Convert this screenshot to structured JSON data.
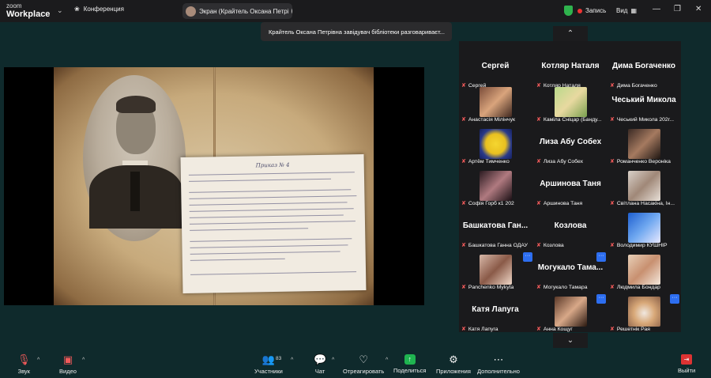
{
  "app": {
    "zoom_label": "zoom",
    "workplace_label": "Workplace"
  },
  "topbar": {
    "conference_label": "Конференция",
    "screen_share_label": "Экран (Крайтель Оксана Петрі",
    "record_label": "Запись",
    "view_label": "Вид"
  },
  "tooltip": {
    "text": "Крайтель Оксана Петрівна завідувач бібліотеки разговариваєт..."
  },
  "shared_screen": {
    "document_title": "Приказ № 4"
  },
  "participants": [
    {
      "big": "Сергей",
      "label": "Сергей"
    },
    {
      "big": "Котляр Наталя",
      "label": "Котляр Наталя"
    },
    {
      "big": "Дима Богаченко",
      "label": "Дима Богаченко"
    },
    {
      "big": "",
      "label": "Анастасія Мілінчук"
    },
    {
      "big": "",
      "label": "Каміла Сніцар (Банду..."
    },
    {
      "big": "Чеський Микола",
      "label": "Чеський Микола 202г..."
    },
    {
      "big": "",
      "label": "Артём Тимченко"
    },
    {
      "big": "Лиза Абу Собех",
      "label": "Лиза Абу Собех"
    },
    {
      "big": "",
      "label": "Романченко Вероніка"
    },
    {
      "big": "",
      "label": "Софія Горб к1 202"
    },
    {
      "big": "Аршинова Таня",
      "label": "Аршинова Таня"
    },
    {
      "big": "",
      "label": "Світлана Насакіна, Ін..."
    },
    {
      "big": "Башкатова Ган...",
      "label": "Башкатова Ганна ОДАУ"
    },
    {
      "big": "Козлова",
      "label": "Козлова"
    },
    {
      "big": "",
      "label": "Володимир КУШНІР"
    },
    {
      "big": "",
      "label": "Panchenko Mykyta"
    },
    {
      "big": "Могукало Тама...",
      "label": "Могукало Тамара"
    },
    {
      "big": "",
      "label": "Людмила Бондар"
    },
    {
      "big": "Катя Лапуга",
      "label": "Катя Лапуга"
    },
    {
      "big": "",
      "label": "Анна Кощуг"
    },
    {
      "big": "",
      "label": "Решетнік Рая"
    }
  ],
  "toolbar": {
    "audio": "Звук",
    "video": "Видео",
    "participants": "Участники",
    "participants_count": "83",
    "chat": "Чат",
    "react": "Отреагировать",
    "share": "Поделиться",
    "apps": "Приложения",
    "more": "Дополнительно",
    "leave": "Выйти"
  },
  "colors": {
    "background": "#0f2a2c",
    "share_green": "#1fb450",
    "leave_red": "#dd3333",
    "mic_off": "#f05a5a",
    "record_red": "#ee3333"
  }
}
